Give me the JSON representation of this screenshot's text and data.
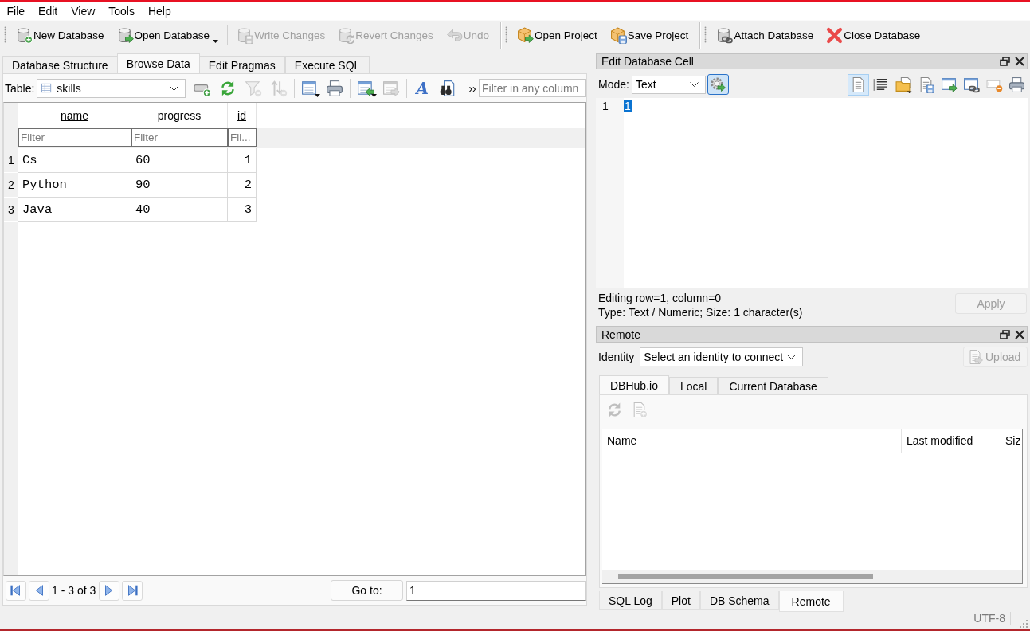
{
  "menu": [
    {
      "label": "File"
    },
    {
      "label": "Edit"
    },
    {
      "label": "View"
    },
    {
      "label": "Tools"
    },
    {
      "label": "Help"
    }
  ],
  "toolbars": [
    {
      "groups": [
        [
          {
            "label": "New Database",
            "disabled": false,
            "dropdown": false
          },
          {
            "label": "Open Database",
            "disabled": false,
            "dropdown": true
          }
        ],
        [
          {
            "label": "Write Changes",
            "disabled": true,
            "dropdown": false
          },
          {
            "label": "Revert Changes",
            "disabled": true,
            "dropdown": false
          },
          {
            "label": "Undo",
            "disabled": true,
            "dropdown": false
          }
        ]
      ]
    },
    {
      "groups": [
        [
          {
            "label": "Open Project",
            "disabled": false,
            "dropdown": false
          },
          {
            "label": "Save Project",
            "disabled": false,
            "dropdown": false
          }
        ]
      ]
    },
    {
      "groups": [
        [
          {
            "label": "Attach Database",
            "disabled": false,
            "dropdown": false
          },
          {
            "label": "Close Database",
            "disabled": false,
            "dropdown": false
          }
        ]
      ]
    }
  ],
  "main_tabs": [
    {
      "label": "Database Structure",
      "selected": false
    },
    {
      "label": "Browse Data",
      "selected": true
    },
    {
      "label": "Edit Pragmas",
      "selected": false
    },
    {
      "label": "Execute SQL",
      "selected": false
    }
  ],
  "browse": {
    "table_label": "Table:",
    "table": "skills",
    "tool_groups": [
      [
        {
          "disabled": false,
          "dropdown": false
        },
        {
          "disabled": false,
          "dropdown": false
        },
        {
          "disabled": true,
          "dropdown": false
        },
        {
          "disabled": true,
          "dropdown": false
        }
      ],
      [
        {
          "disabled": false,
          "dropdown": true
        },
        {
          "disabled": false,
          "dropdown": false
        }
      ],
      [
        {
          "disabled": false,
          "dropdown": true
        },
        {
          "disabled": true,
          "dropdown": false
        }
      ],
      [
        {
          "glyph": "A",
          "disabled": false,
          "dropdown": false
        },
        {
          "disabled": false,
          "dropdown": false
        }
      ]
    ],
    "more": "››",
    "filter_placeholder": "Filter in any column",
    "columns": [
      {
        "label": "name",
        "underlined": true,
        "numeric": false,
        "filter_placeholder": "Filter"
      },
      {
        "label": "progress",
        "underlined": false,
        "numeric": false,
        "filter_placeholder": "Filter"
      },
      {
        "label": "id",
        "underlined": true,
        "numeric": true,
        "filter_placeholder": "Fil..."
      }
    ],
    "rows": [
      {
        "number": "1",
        "cells": [
          "Cs",
          "60",
          "1"
        ]
      },
      {
        "number": "2",
        "cells": [
          "Python",
          "90",
          "2"
        ]
      },
      {
        "number": "3",
        "cells": [
          "Java",
          "40",
          "3"
        ]
      }
    ],
    "pager": {
      "status": "1 - 3 of 3",
      "goto_label": "Go to:",
      "goto_value": "1"
    }
  },
  "edit_cell": {
    "title": "Edit Database Cell",
    "mode_label": "Mode:",
    "mode": "Text",
    "auto_switch": true,
    "tools": [
      {
        "on": true
      },
      {
        "on": false
      },
      {
        "on": false
      },
      {
        "on": false
      },
      {
        "on": false
      },
      {
        "on": false
      },
      {
        "on": false
      },
      {
        "on": false
      }
    ],
    "line_number": "1",
    "value": {
      "text": "1",
      "selected": true
    },
    "status": [
      "Editing row=1, column=0",
      "Type: Text / Numeric; Size: 1 character(s)"
    ],
    "apply": {
      "label": "Apply",
      "disabled": true
    }
  },
  "remote": {
    "title": "Remote",
    "identity_label": "Identity",
    "identity": "Select an identity to connect",
    "upload": {
      "label": "Upload",
      "disabled": true
    },
    "tabs": [
      {
        "label": "DBHub.io",
        "selected": true
      },
      {
        "label": "Local",
        "selected": false
      },
      {
        "label": "Current Database",
        "selected": false
      }
    ],
    "tools": [
      {
        "disabled": true
      },
      {
        "disabled": true
      }
    ],
    "columns": [
      "Name",
      "Last modified",
      "Siz"
    ]
  },
  "dock_tabs": [
    {
      "label": "SQL Log",
      "selected": false
    },
    {
      "label": "Plot",
      "selected": false
    },
    {
      "label": "DB Schema",
      "selected": false
    },
    {
      "label": "Remote",
      "selected": true
    }
  ],
  "status_bar": {
    "encoding": "UTF-8"
  }
}
